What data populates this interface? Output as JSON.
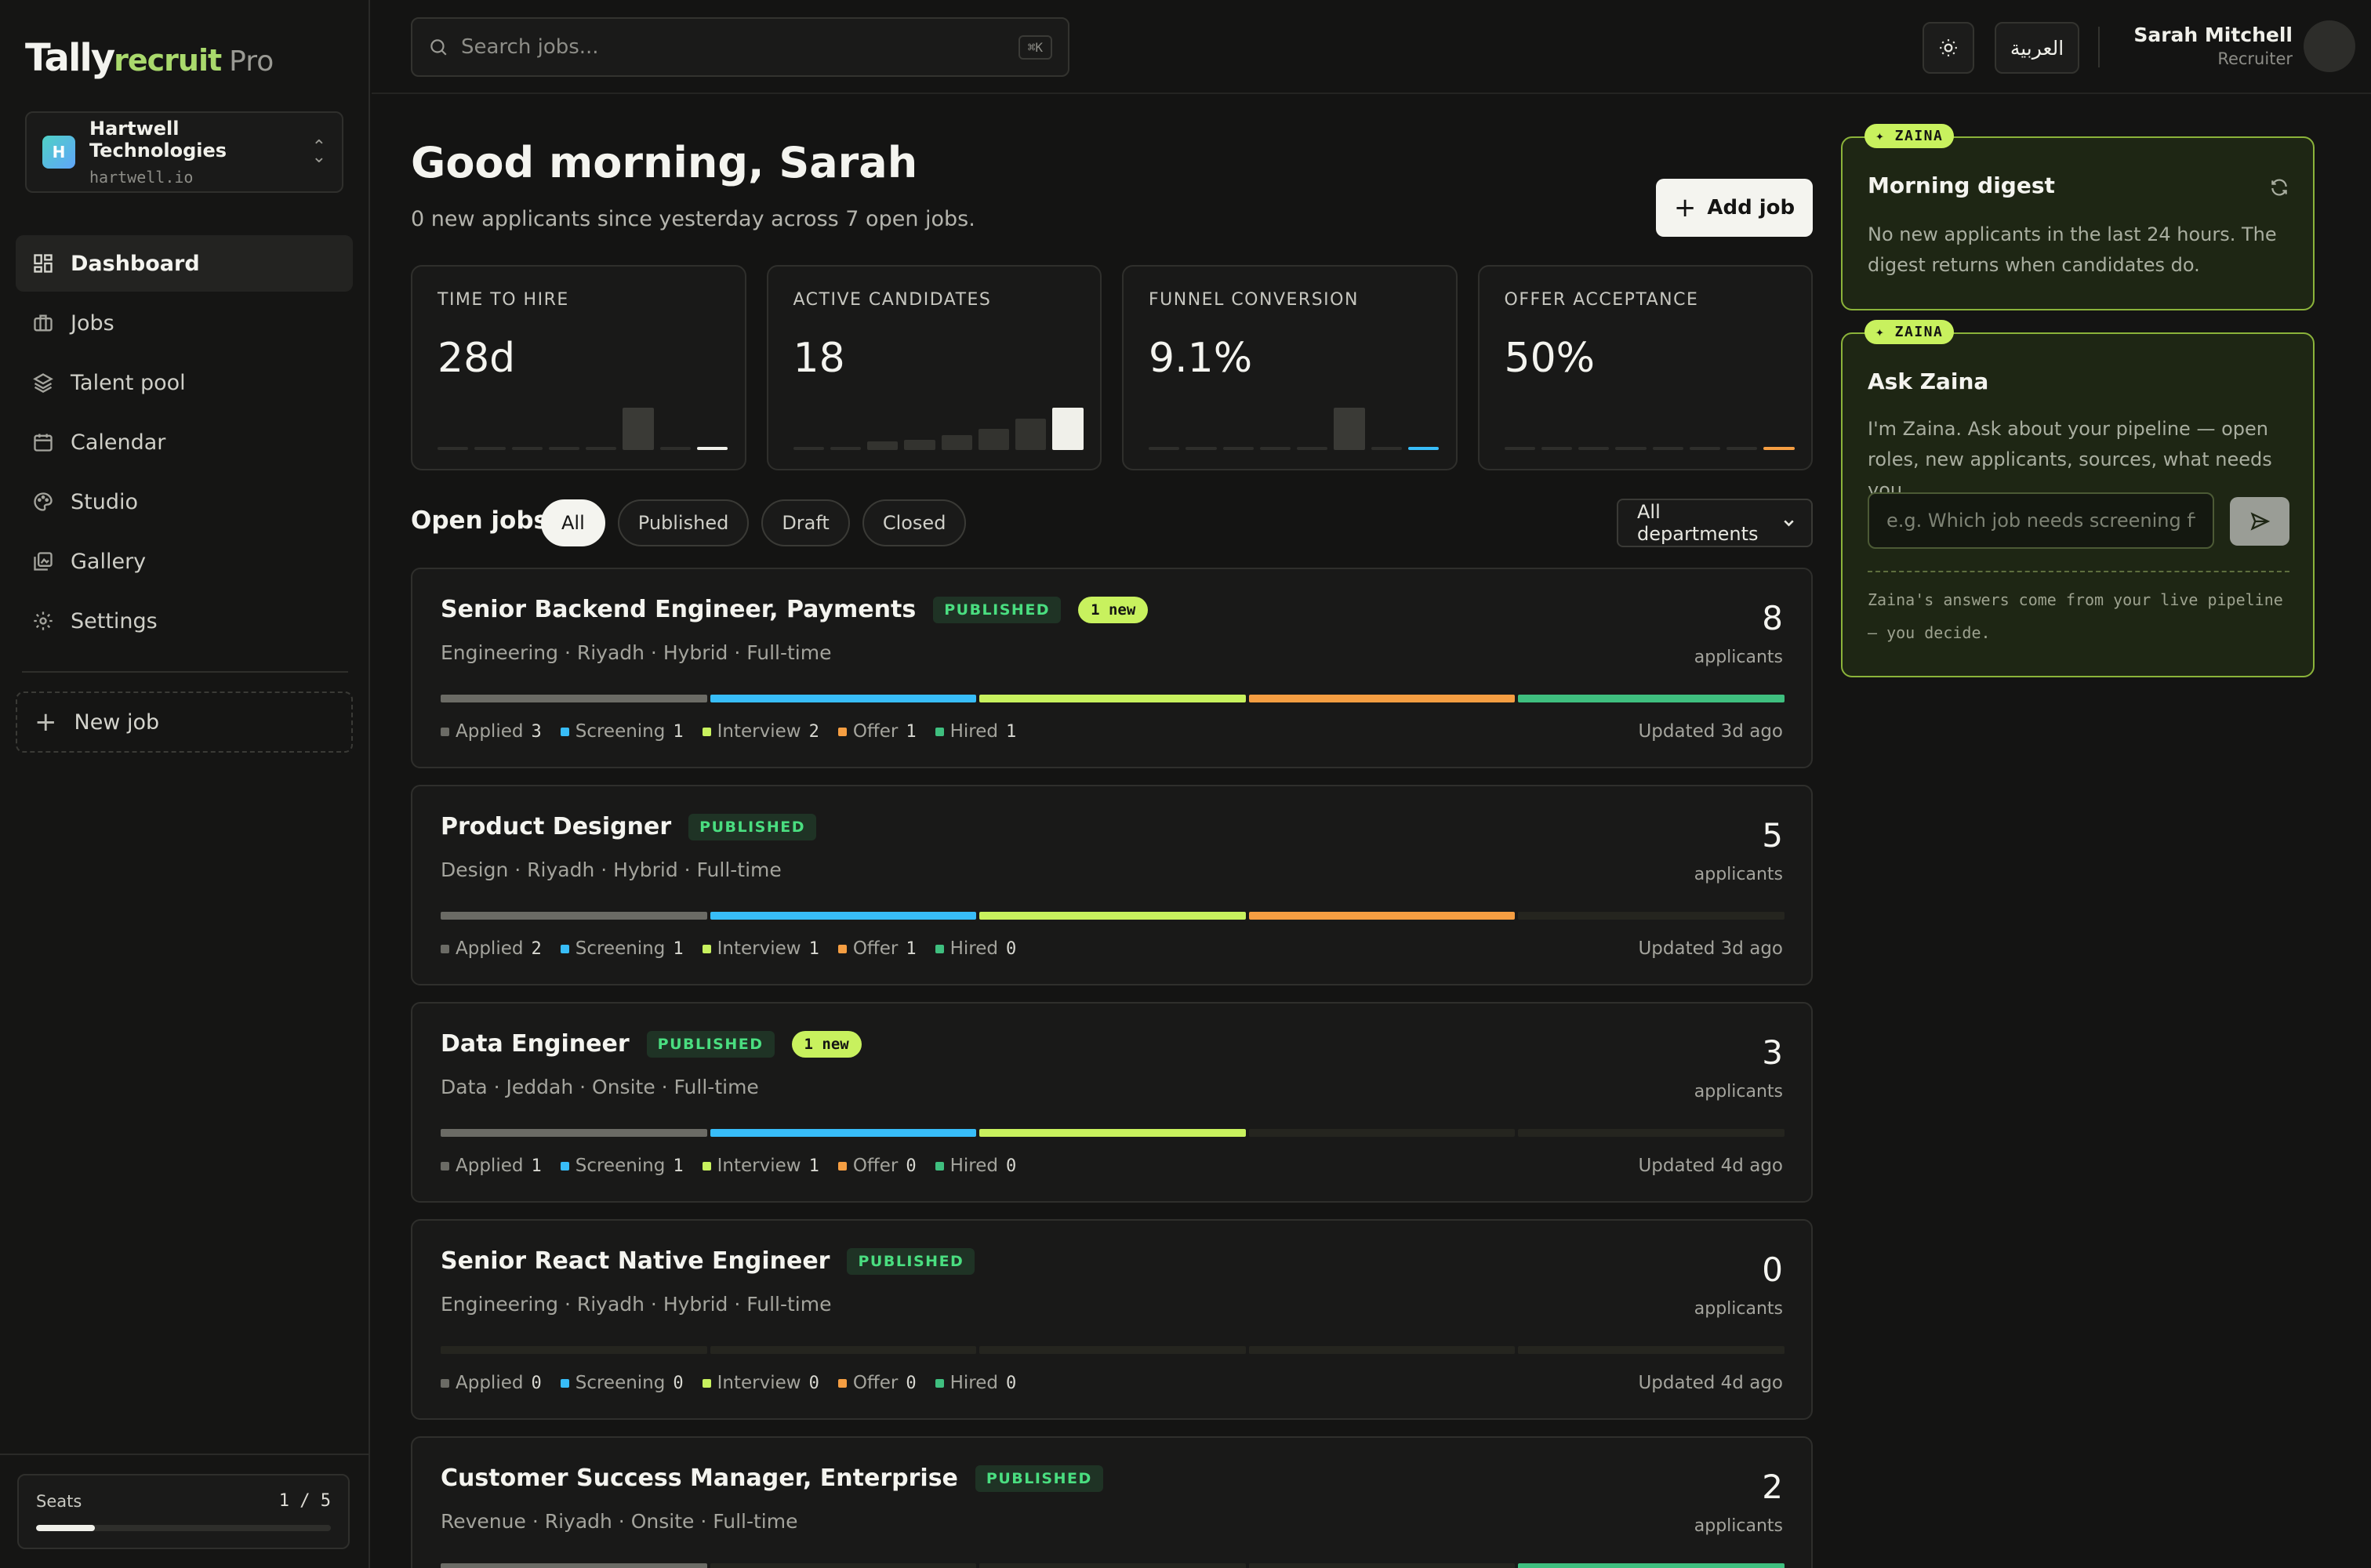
{
  "app": {
    "logo_part1": "Tally",
    "logo_part2": "recruit",
    "logo_part3": "Pro"
  },
  "org": {
    "initial": "H",
    "name": "Hartwell Technologies",
    "domain": "hartwell.io"
  },
  "sidebar": {
    "items": [
      {
        "label": "Dashboard",
        "icon": "dashboard-icon",
        "active": true
      },
      {
        "label": "Jobs",
        "icon": "briefcase-icon"
      },
      {
        "label": "Talent pool",
        "icon": "layers-icon"
      },
      {
        "label": "Calendar",
        "icon": "calendar-icon"
      },
      {
        "label": "Studio",
        "icon": "palette-icon"
      },
      {
        "label": "Gallery",
        "icon": "gallery-icon"
      },
      {
        "label": "Settings",
        "icon": "gear-icon"
      }
    ],
    "new_job": "New job",
    "seats_label": "Seats",
    "seats_count": "1 / 5",
    "seats_fraction": 0.2
  },
  "topbar": {
    "search_placeholder": "Search jobs...",
    "search_shortcut": "⌘K",
    "language": "العربية",
    "user_name": "Sarah Mitchell",
    "user_role": "Recruiter"
  },
  "main": {
    "greeting": "Good morning, Sarah",
    "subtitle": "0 new applicants since yesterday across 7 open jobs.",
    "add_job": "Add job",
    "kpis": [
      {
        "label": "TIME TO HIRE",
        "value": "28d",
        "spark": [
          0,
          0,
          0,
          0,
          0,
          1,
          0,
          0.08
        ],
        "accent": "#f0f0ea"
      },
      {
        "label": "ACTIVE CANDIDATES",
        "value": "18",
        "spark": [
          0,
          0,
          0.2,
          0.25,
          0.35,
          0.5,
          0.75,
          1
        ],
        "accent": "#f0f0ea"
      },
      {
        "label": "FUNNEL CONVERSION",
        "value": "9.1%",
        "spark": [
          0,
          0,
          0,
          0,
          0,
          1,
          0,
          0.08
        ],
        "accent": "#38bdf8"
      },
      {
        "label": "OFFER ACCEPTANCE",
        "value": "50%",
        "spark": [
          0,
          0,
          0,
          0,
          0,
          0,
          0,
          0.08
        ],
        "accent": "#f59e42"
      }
    ],
    "jobs_title": "Open jobs",
    "filters": [
      {
        "label": "All",
        "active": true
      },
      {
        "label": "Published"
      },
      {
        "label": "Draft"
      },
      {
        "label": "Closed"
      }
    ],
    "department": "All departments",
    "stage_labels": [
      "Applied",
      "Screening",
      "Interview",
      "Offer",
      "Hired"
    ],
    "stage_colors": [
      "#6b6b65",
      "#38bdf8",
      "#c8f15e",
      "#f59e42",
      "#3fbf7f"
    ],
    "applicants_label": "applicants",
    "jobs": [
      {
        "title": "Senior Backend Engineer, Payments",
        "status": "PUBLISHED",
        "new": "1 new",
        "meta": "Engineering · Riyadh · Hybrid · Full-time",
        "count": "8",
        "stages": [
          3,
          1,
          2,
          1,
          1
        ],
        "updated": "Updated 3d ago"
      },
      {
        "title": "Product Designer",
        "status": "PUBLISHED",
        "new": "",
        "meta": "Design · Riyadh · Hybrid · Full-time",
        "count": "5",
        "stages": [
          2,
          1,
          1,
          1,
          0
        ],
        "updated": "Updated 3d ago"
      },
      {
        "title": "Data Engineer",
        "status": "PUBLISHED",
        "new": "1 new",
        "meta": "Data · Jeddah · Onsite · Full-time",
        "count": "3",
        "stages": [
          1,
          1,
          1,
          0,
          0
        ],
        "updated": "Updated 4d ago"
      },
      {
        "title": "Senior React Native Engineer",
        "status": "PUBLISHED",
        "new": "",
        "meta": "Engineering · Riyadh · Hybrid · Full-time",
        "count": "0",
        "stages": [
          0,
          0,
          0,
          0,
          0
        ],
        "updated": "Updated 4d ago"
      },
      {
        "title": "Customer Success Manager, Enterprise",
        "status": "PUBLISHED",
        "new": "",
        "meta": "Revenue · Riyadh · Onsite · Full-time",
        "count": "2",
        "stages": [
          1,
          0,
          0,
          0,
          1
        ],
        "updated": ""
      }
    ]
  },
  "zaina": {
    "tag": "✦ ZAINA",
    "digest_title": "Morning digest",
    "digest_text": "No new applicants in the last 24 hours. The digest returns when candidates do.",
    "ask_title": "Ask Zaina",
    "ask_text": "I'm Zaina. Ask about your pipeline — open roles, new applicants, sources, what needs you.",
    "ask_placeholder": "e.g. Which job needs screening first?",
    "footer": "Zaina's answers come from your live pipeline — you decide."
  }
}
